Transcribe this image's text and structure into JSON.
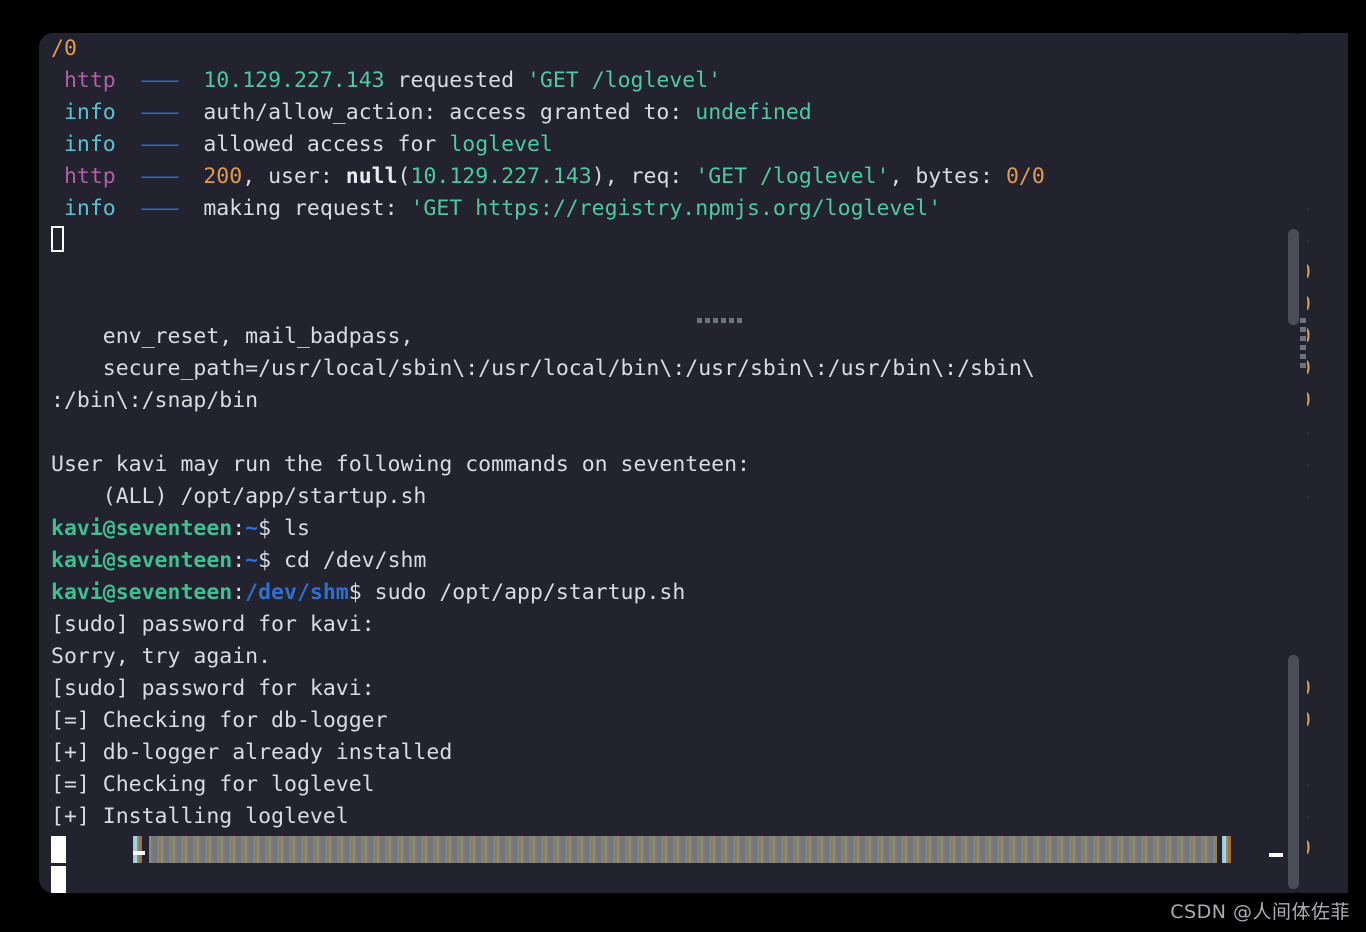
{
  "window": {
    "type": "terminal-emulator",
    "background_color": "#22232e",
    "desktop_color": "#000000",
    "foreground_color": "#d8dbe2"
  },
  "terminal": {
    "lines": [
      {
        "id": "line-zero-slash",
        "segments": [
          {
            "text": "/0",
            "color": "#e09a52",
            "class": "c-orange"
          }
        ]
      },
      {
        "id": "line-http-requested",
        "segments": [
          {
            "text": " ",
            "class": "c-default"
          },
          {
            "text": "http",
            "class": "c-magenta"
          },
          {
            "text": "  ",
            "class": "c-default"
          },
          {
            "text": "———",
            "class": "dash"
          },
          {
            "text": "  ",
            "class": "c-default"
          },
          {
            "text": "10.129.227.143",
            "class": "c-green"
          },
          {
            "text": " requested ",
            "class": "c-default"
          },
          {
            "text": "'GET /loglevel'",
            "class": "c-green"
          }
        ]
      },
      {
        "id": "line-info-allow-action",
        "segments": [
          {
            "text": " ",
            "class": "c-default"
          },
          {
            "text": "info",
            "class": "c-cyan"
          },
          {
            "text": "  ",
            "class": "c-default"
          },
          {
            "text": "———",
            "class": "dash"
          },
          {
            "text": "  ",
            "class": "c-default"
          },
          {
            "text": "auth/allow_action: access granted to: ",
            "class": "c-default"
          },
          {
            "text": "undefined",
            "class": "c-green"
          }
        ]
      },
      {
        "id": "line-info-allowed-access",
        "segments": [
          {
            "text": " ",
            "class": "c-default"
          },
          {
            "text": "info",
            "class": "c-cyan"
          },
          {
            "text": "  ",
            "class": "c-default"
          },
          {
            "text": "———",
            "class": "dash"
          },
          {
            "text": "  ",
            "class": "c-default"
          },
          {
            "text": "allowed access for ",
            "class": "c-default"
          },
          {
            "text": "loglevel",
            "class": "c-green"
          }
        ]
      },
      {
        "id": "line-http-200",
        "segments": [
          {
            "text": " ",
            "class": "c-default"
          },
          {
            "text": "http",
            "class": "c-magenta"
          },
          {
            "text": "  ",
            "class": "c-default"
          },
          {
            "text": "———",
            "class": "dash"
          },
          {
            "text": "  ",
            "class": "c-default"
          },
          {
            "text": "200",
            "class": "c-orange"
          },
          {
            "text": ", user: ",
            "class": "c-default"
          },
          {
            "text": "null",
            "class": "c-white c-bold"
          },
          {
            "text": "(",
            "class": "c-default"
          },
          {
            "text": "10.129.227.143",
            "class": "c-green"
          },
          {
            "text": "), req: ",
            "class": "c-default"
          },
          {
            "text": "'GET /loglevel'",
            "class": "c-green"
          },
          {
            "text": ", bytes: ",
            "class": "c-default"
          },
          {
            "text": "0/0",
            "class": "c-orange"
          }
        ]
      },
      {
        "id": "line-info-making-request",
        "segments": [
          {
            "text": " ",
            "class": "c-default"
          },
          {
            "text": "info",
            "class": "c-cyan"
          },
          {
            "text": "  ",
            "class": "c-default"
          },
          {
            "text": "———",
            "class": "dash"
          },
          {
            "text": "  ",
            "class": "c-default"
          },
          {
            "text": "making request: ",
            "class": "c-default"
          },
          {
            "text": "'GET https://registry.npmjs.org/loglevel'",
            "class": "c-green"
          }
        ]
      },
      {
        "id": "line-cursor-hollow",
        "cursor": "hollow",
        "segments": []
      },
      {
        "id": "line-blank-1",
        "segments": []
      },
      {
        "id": "line-fold-marker",
        "segments": []
      },
      {
        "id": "line-env-reset",
        "segments": [
          {
            "text": "    env_reset, mail_badpass,",
            "class": "c-default"
          }
        ]
      },
      {
        "id": "line-secure-path",
        "segments": [
          {
            "text": "    secure_path=/usr/local/sbin\\:/usr/local/bin\\:/usr/sbin\\:/usr/bin\\:/sbin\\",
            "class": "c-default"
          }
        ]
      },
      {
        "id": "line-secure-path-wrap",
        "segments": [
          {
            "text": ":/bin\\:/snap/bin",
            "class": "c-default"
          }
        ]
      },
      {
        "id": "line-blank-2",
        "segments": []
      },
      {
        "id": "line-user-may-run",
        "segments": [
          {
            "text": "User kavi may run the following commands on seventeen:",
            "class": "c-default"
          }
        ]
      },
      {
        "id": "line-all-startup",
        "segments": [
          {
            "text": "    (ALL) /opt/app/startup.sh",
            "class": "c-default"
          }
        ]
      },
      {
        "id": "line-prompt-ls",
        "segments": [
          {
            "text": "kavi@seventeen",
            "class": "c-green2 c-bold"
          },
          {
            "text": ":",
            "class": "c-default"
          },
          {
            "text": "~",
            "class": "c-blue2 c-bold"
          },
          {
            "text": "$ ls",
            "class": "c-default"
          }
        ]
      },
      {
        "id": "line-prompt-cd",
        "segments": [
          {
            "text": "kavi@seventeen",
            "class": "c-green2 c-bold"
          },
          {
            "text": ":",
            "class": "c-default"
          },
          {
            "text": "~",
            "class": "c-blue2 c-bold"
          },
          {
            "text": "$ cd /dev/shm",
            "class": "c-default"
          }
        ]
      },
      {
        "id": "line-prompt-sudo",
        "segments": [
          {
            "text": "kavi@seventeen",
            "class": "c-green2 c-bold"
          },
          {
            "text": ":",
            "class": "c-default"
          },
          {
            "text": "/dev/shm",
            "class": "c-blue2 c-bold"
          },
          {
            "text": "$ sudo /opt/app/startup.sh",
            "class": "c-default"
          }
        ]
      },
      {
        "id": "line-sudo-password-1",
        "segments": [
          {
            "text": "[sudo] password for kavi:",
            "class": "c-default"
          }
        ]
      },
      {
        "id": "line-sorry-try-again",
        "segments": [
          {
            "text": "Sorry, try again.",
            "class": "c-default"
          }
        ]
      },
      {
        "id": "line-sudo-password-2",
        "segments": [
          {
            "text": "[sudo] password for kavi:",
            "class": "c-default"
          }
        ]
      },
      {
        "id": "line-check-db-logger",
        "segments": [
          {
            "text": "[=] Checking for db-logger",
            "class": "c-default"
          }
        ]
      },
      {
        "id": "line-db-logger-installed",
        "segments": [
          {
            "text": "[+] db-logger already installed",
            "class": "c-default"
          }
        ]
      },
      {
        "id": "line-check-loglevel",
        "segments": [
          {
            "text": "[=] Checking for loglevel",
            "class": "c-default"
          }
        ]
      },
      {
        "id": "line-installing-loglevel",
        "segments": [
          {
            "text": "[+] Installing loglevel",
            "class": "c-default"
          }
        ]
      },
      {
        "id": "line-progress-bar",
        "progress": true,
        "segments": []
      },
      {
        "id": "line-cursor-block",
        "cursor": "block",
        "segments": []
      }
    ]
  },
  "back_pane": {
    "label": "partially-occluded-terminal-pane",
    "fragments": [
      "]",
      "]",
      "0",
      "0",
      "]",
      "-",
      "-",
      "0",
      "0",
      "0",
      "0",
      "0",
      "-",
      "-",
      "-",
      "|",
      "]",
      "|"
    ]
  },
  "scrollbars": {
    "top_thumb_label": "scrollbar-thumb-upper",
    "bottom_thumb_label": "scrollbar-thumb-lower"
  },
  "watermark": {
    "text": "CSDN @人间体佐菲"
  }
}
